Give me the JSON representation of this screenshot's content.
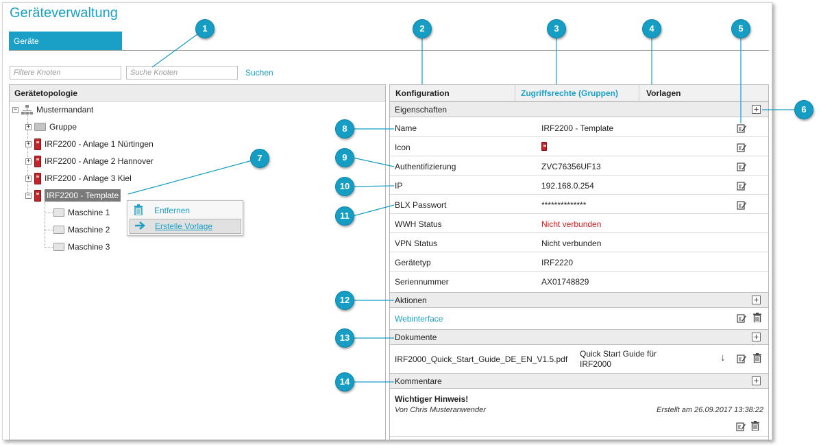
{
  "app": {
    "title": "Geräteverwaltung"
  },
  "tabs": {
    "geraete": "Geräte"
  },
  "filters": {
    "filter_placeholder": "Filtere Knoten",
    "search_placeholder": "Suche Knoten",
    "search_label": "Suchen"
  },
  "topology": {
    "header": "Gerätetopologie",
    "root": "Mustermandant",
    "nodes": [
      {
        "label": "Gruppe",
        "icon": "folder-icon"
      },
      {
        "label": "IRF2200 - Anlage 1 Nürtingen",
        "icon": "device-icon"
      },
      {
        "label": "IRF2200 - Anlage 2 Hannover",
        "icon": "device-icon"
      },
      {
        "label": "IRF2200 - Anlage 3 Kiel",
        "icon": "device-icon"
      },
      {
        "label": "IRF2200 - Template",
        "icon": "device-icon"
      }
    ],
    "machines": [
      "Maschine 1",
      "Maschine 2",
      "Maschine 3"
    ]
  },
  "context_menu": {
    "items": [
      {
        "label": "Entfernen",
        "icon": "trash-icon"
      },
      {
        "label": "Erstelle Vorlage",
        "icon": "arrow-right-icon"
      }
    ]
  },
  "detail_tabs": [
    "Konfiguration",
    "Zugriffsrechte (Gruppen)",
    "Vorlagen"
  ],
  "properties": {
    "header": "Eigenschaften",
    "rows": [
      {
        "label": "Name",
        "value": "IRF2200 - Template"
      },
      {
        "label": "Icon",
        "value": ""
      },
      {
        "label": "Authentifizierung",
        "value": "ZVC76356UF13"
      },
      {
        "label": "IP",
        "value": "192.168.0.254"
      },
      {
        "label": "BLX Passwort",
        "value": "**************"
      },
      {
        "label": "WWH Status",
        "value": "Nicht verbunden"
      },
      {
        "label": "VPN Status",
        "value": "Nicht verbunden"
      },
      {
        "label": "Gerätetyp",
        "value": "IRF2220"
      },
      {
        "label": "Seriennummer",
        "value": "AX01748829"
      }
    ]
  },
  "actions": {
    "header": "Aktionen",
    "webinterface": "Webinterface"
  },
  "documents": {
    "header": "Dokumente",
    "file": "IRF2000_Quick_Start_Guide_DE_EN_V1.5.pdf",
    "desc_line1": "Quick Start Guide für",
    "desc_line2": "IRF2000"
  },
  "comments": {
    "header": "Kommentare",
    "title": "Wichtiger Hinweis!",
    "author": "Von Chris Musteranwender",
    "created": "Erstellt am 26.09.2017 13:38:22"
  },
  "callouts": [
    "1",
    "2",
    "3",
    "4",
    "5",
    "6",
    "7",
    "8",
    "9",
    "10",
    "11",
    "12",
    "13",
    "14"
  ],
  "colors": {
    "accent": "#1aa0c7",
    "status_red": "#d11a1a",
    "device_red": "#c2262b",
    "callout": "#159dc4"
  }
}
